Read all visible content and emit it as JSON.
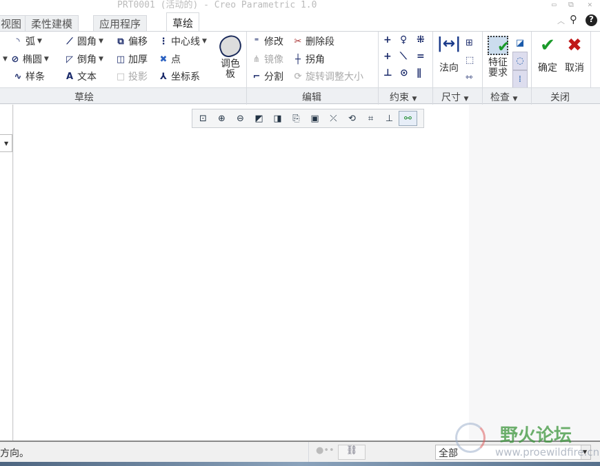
{
  "title": "PRT0001 (活动的) - Creo Parametric 1.0",
  "tabs": [
    "视图",
    "柔性建模",
    "应用程序",
    "草绘"
  ],
  "sketch": {
    "arc": "弧",
    "ellipse": "椭圆",
    "spline": "样条",
    "fillet": "圆角",
    "chamfer": "倒角",
    "text": "文本",
    "offset": "偏移",
    "thicken": "加厚",
    "project": "投影",
    "centerline": "中心线",
    "point": "点",
    "csys": "坐标系",
    "palette": "调色板"
  },
  "edit": {
    "modify": "修改",
    "delete_segment": "删除段",
    "mirror": "镜像",
    "corner": "拐角",
    "divide": "分割",
    "rotate_resize": "旋转调整大小"
  },
  "dimension": {
    "normal": "法向"
  },
  "inspect": {
    "feature_req": "特征要求"
  },
  "close": {
    "ok": "确定",
    "cancel": "取消"
  },
  "groups": {
    "sketch": "草绘",
    "edit": "编辑",
    "constrain": "约束",
    "dimension": "尺寸",
    "inspect": "检查",
    "close": "关闭"
  },
  "status": {
    "message": "方向。",
    "filter": "全部"
  },
  "watermark": {
    "name": "野火论坛",
    "url": "www.proewildfire.cn"
  }
}
